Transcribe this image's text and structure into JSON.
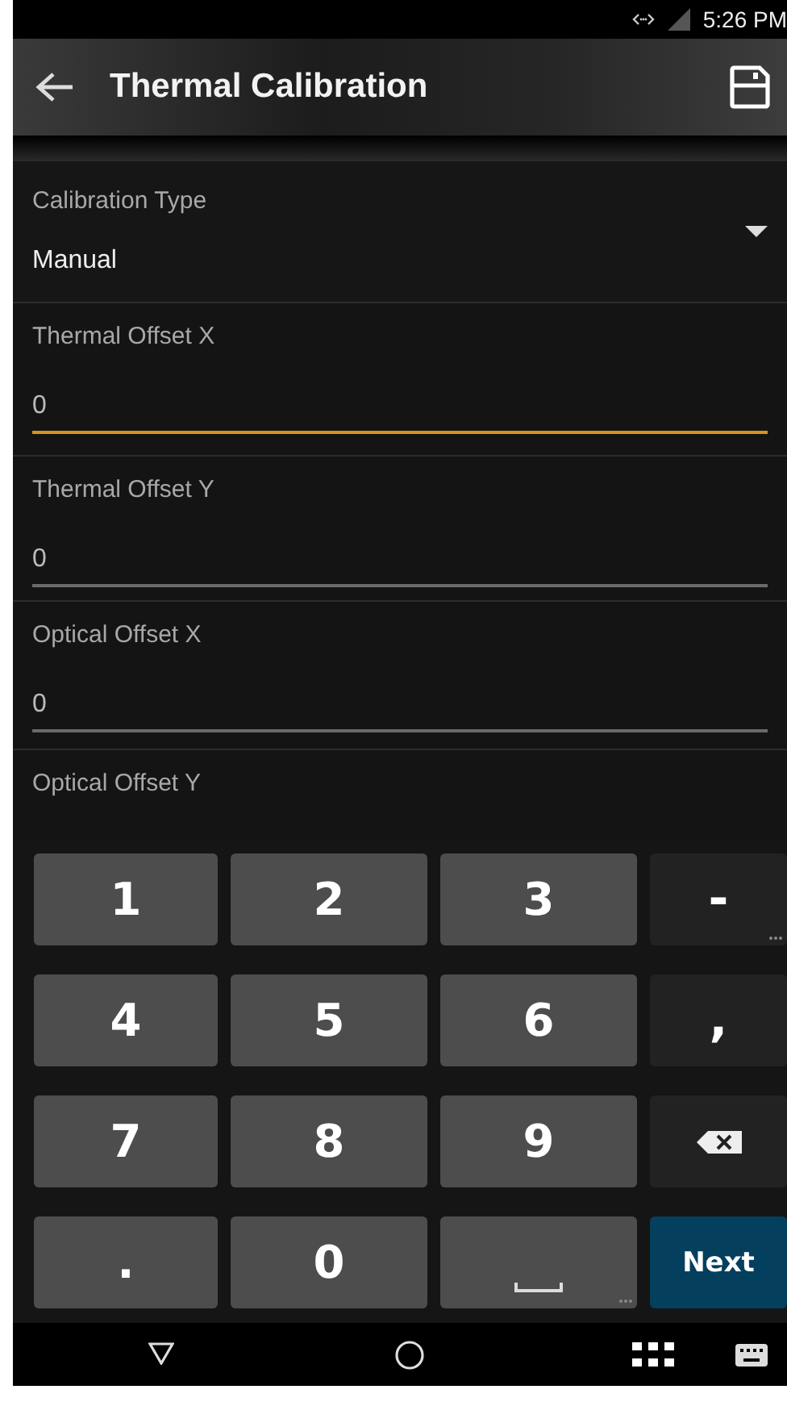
{
  "status_bar": {
    "time": "5:26 PM"
  },
  "app_bar": {
    "title": "Thermal Calibration"
  },
  "dropdown": {
    "label": "Calibration Type",
    "value": "Manual"
  },
  "fields": [
    {
      "label": "Thermal Offset X",
      "value": "0",
      "focused": true
    },
    {
      "label": "Thermal Offset Y",
      "value": "0",
      "focused": false
    },
    {
      "label": "Optical Offset X",
      "value": "0",
      "focused": false
    },
    {
      "label": "Optical Offset Y"
    }
  ],
  "keyboard": {
    "keys": [
      {
        "kind": "digit",
        "label": "1"
      },
      {
        "kind": "digit",
        "label": "2"
      },
      {
        "kind": "digit",
        "label": "3"
      },
      {
        "kind": "symbol",
        "label": "-",
        "more": true
      },
      {
        "kind": "digit",
        "label": "4"
      },
      {
        "kind": "digit",
        "label": "5"
      },
      {
        "kind": "digit",
        "label": "6"
      },
      {
        "kind": "symbol",
        "label": ","
      },
      {
        "kind": "digit",
        "label": "7"
      },
      {
        "kind": "digit",
        "label": "8"
      },
      {
        "kind": "digit",
        "label": "9"
      },
      {
        "kind": "backspace"
      },
      {
        "kind": "digit",
        "label": "."
      },
      {
        "kind": "digit",
        "label": "0"
      },
      {
        "kind": "space",
        "more": true
      },
      {
        "kind": "action",
        "label": "Next"
      }
    ]
  }
}
